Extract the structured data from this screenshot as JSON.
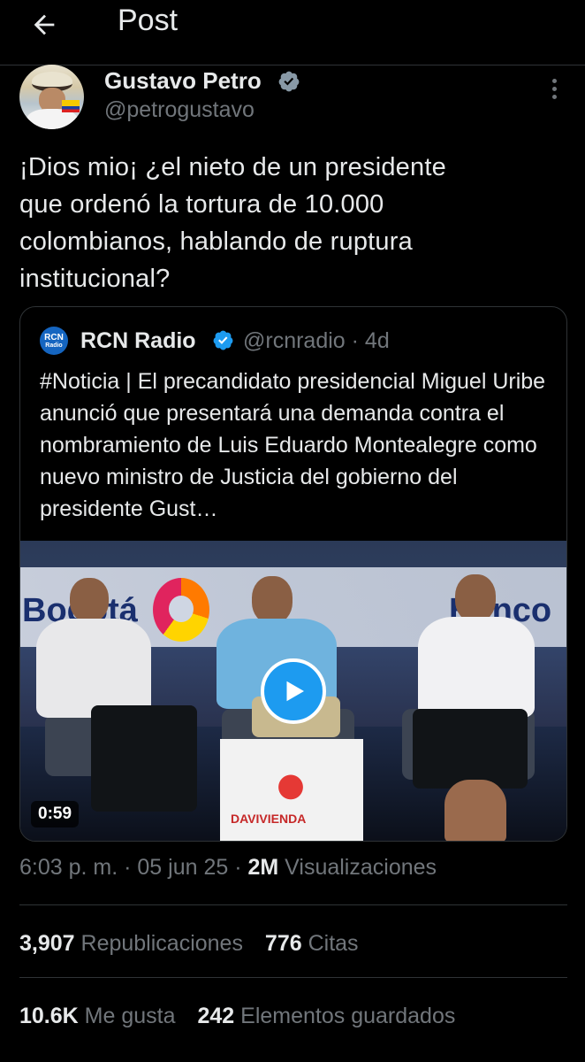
{
  "header": {
    "title": "Post",
    "back_icon": "arrow-left-icon"
  },
  "post": {
    "author_name": "Gustavo Petro",
    "author_handle": "@petrogustavo",
    "verified_color": "#1d9bf0",
    "text": "¡Dios mio¡ ¿el nieto de un presidente\nque ordenó la tortura de 10.000\ncolombianos, hablando de ruptura\ninstitucional?"
  },
  "quote": {
    "logo_text_top": "RCN",
    "logo_text_bottom": "Radio",
    "name": "RCN Radio",
    "handle_time": "@rcnradio · 4d",
    "text": "#Noticia | El precandidato presidencial Miguel Uribe anunció que presentará una demanda contra el nombramiento de Luis Eduardo Montealegre como nuevo ministro de Justicia del gobierno del presidente Gust…",
    "video": {
      "duration": "0:59",
      "banner_left": "Bogotá",
      "banner_right": "Banco d",
      "podium_text": "DAVIVIENDA"
    }
  },
  "meta": {
    "time": "6:03 p. m.",
    "sep1": " · ",
    "date": "05 jun 25",
    "sep2": " · ",
    "views_count": "2M",
    "views_label": " Visualizaciones"
  },
  "stats": {
    "reposts_count": "3,907",
    "reposts_label": "Republicaciones",
    "quotes_count": "776",
    "quotes_label": "Citas",
    "likes_count": "10.6K",
    "likes_label": "Me gusta",
    "bookmarks_count": "242",
    "bookmarks_label": "Elementos guardados"
  }
}
